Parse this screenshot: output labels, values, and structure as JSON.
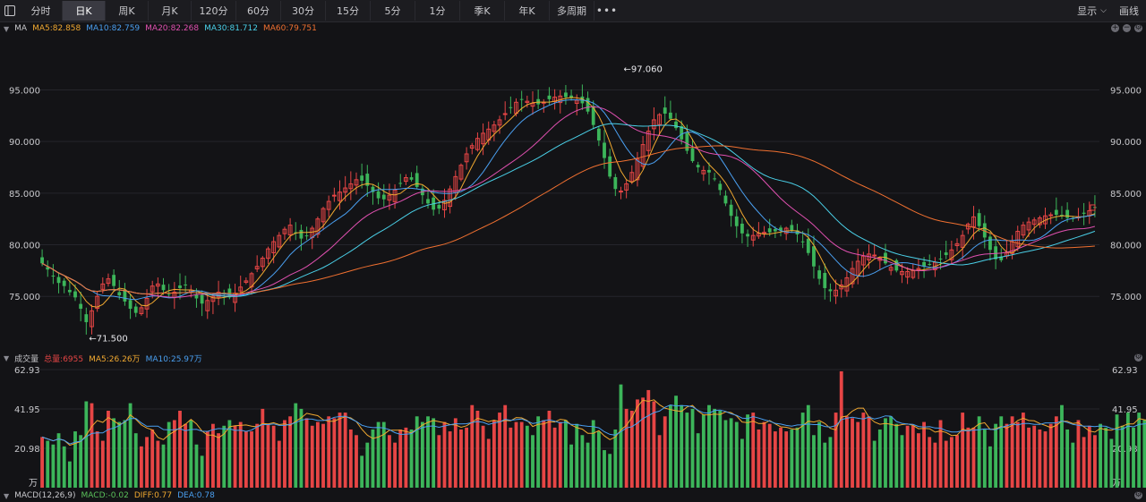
{
  "toolbar": {
    "tabs": [
      {
        "label": "分时"
      },
      {
        "label": "日K"
      },
      {
        "label": "周K"
      },
      {
        "label": "月K"
      },
      {
        "label": "120分"
      },
      {
        "label": "60分"
      },
      {
        "label": "30分"
      },
      {
        "label": "15分"
      },
      {
        "label": "5分"
      },
      {
        "label": "1分"
      },
      {
        "label": "季K"
      },
      {
        "label": "年K"
      },
      {
        "label": "多周期"
      }
    ],
    "active_index": 1,
    "more_label": "•••",
    "display_label": "显示",
    "draw_label": "画线"
  },
  "ma_legend": {
    "title": "MA",
    "items": [
      {
        "text": "MA5:82.858",
        "color": "#f0a830"
      },
      {
        "text": "MA10:82.759",
        "color": "#4a9ff0"
      },
      {
        "text": "MA20:82.268",
        "color": "#e050b0"
      },
      {
        "text": "MA30:81.712",
        "color": "#4ad0e8"
      },
      {
        "text": "MA60:79.751",
        "color": "#f07030"
      }
    ]
  },
  "volume_legend": {
    "title": "成交量",
    "items": [
      {
        "text": "总量:6955",
        "color": "#e64545"
      },
      {
        "text": "MA5:26.26万",
        "color": "#f0a830"
      },
      {
        "text": "MA10:25.97万",
        "color": "#4a9ff0"
      }
    ]
  },
  "macd_legend": {
    "title": "MACD(12,26,9)",
    "items": [
      {
        "text": "MACD:-0.02",
        "color": "#5ac05a"
      },
      {
        "text": "DIFF:0.77",
        "color": "#f0a830"
      },
      {
        "text": "DEA:0.78",
        "color": "#4a9ff0"
      }
    ]
  },
  "colors": {
    "up": "#e64545",
    "down": "#3cb55a",
    "grid": "#25252b",
    "axis_text": "#c8c8cc"
  },
  "chart_data": [
    {
      "type": "candlestick",
      "title": "",
      "y_ticks": [
        95.0,
        90.0,
        85.0,
        80.0,
        75.0
      ],
      "y_tick_labels": [
        "95.000",
        "90.000",
        "85.000",
        "80.000",
        "75.000"
      ],
      "ylim": [
        70.25,
        99.72
      ],
      "annotations": [
        {
          "label": "←97.060",
          "value": 97.06,
          "index": 105
        },
        {
          "label": "←71.500",
          "value": 71.5,
          "index": 8
        }
      ],
      "closes": [
        78.2,
        77.6,
        77.0,
        76.3,
        76.0,
        75.4,
        74.9,
        73.8,
        72.5,
        73.6,
        75.0,
        76.2,
        76.7,
        76.0,
        75.1,
        74.5,
        73.8,
        73.4,
        73.9,
        74.8,
        76.0,
        76.2,
        75.6,
        75.2,
        75.4,
        75.8,
        76.1,
        75.6,
        74.8,
        74.3,
        74.6,
        75.0,
        75.4,
        75.2,
        74.9,
        75.3,
        75.9,
        76.5,
        77.2,
        77.9,
        78.7,
        79.6,
        80.3,
        80.9,
        81.5,
        81.9,
        81.1,
        80.6,
        80.9,
        81.6,
        82.5,
        83.5,
        84.2,
        84.8,
        85.1,
        85.5,
        85.9,
        86.3,
        86.2,
        85.7,
        85.1,
        84.5,
        84.4,
        84.8,
        85.3,
        85.9,
        86.5,
        86.3,
        85.6,
        84.8,
        84.0,
        83.4,
        83.5,
        84.3,
        85.4,
        86.6,
        87.7,
        88.8,
        89.6,
        90.3,
        90.8,
        91.2,
        91.6,
        92.1,
        92.7,
        93.3,
        93.8,
        94.1,
        93.9,
        93.7,
        93.6,
        93.8,
        94.1,
        94.3,
        94.4,
        94.3,
        94.2,
        94.0,
        93.7,
        92.9,
        91.6,
        90.1,
        88.4,
        86.6,
        85.4,
        85.2,
        85.9,
        87.0,
        88.3,
        89.7,
        91.0,
        92.1,
        92.6,
        92.7,
        92.2,
        91.3,
        90.2,
        89.1,
        88.1,
        87.5,
        87.2,
        87.0,
        86.4,
        85.3,
        84.0,
        82.8,
        81.8,
        81.1,
        80.8,
        80.9,
        81.1,
        81.2,
        81.2,
        81.3,
        81.4,
        81.6,
        81.4,
        81.0,
        80.3,
        79.2,
        77.9,
        76.7,
        75.8,
        75.5,
        75.6,
        76.1,
        76.8,
        77.7,
        78.4,
        78.9,
        79.1,
        79.0,
        78.7,
        78.2,
        77.8,
        77.5,
        77.4,
        77.4,
        77.5,
        77.7,
        77.9,
        78.1,
        78.3,
        78.6,
        79.0,
        79.5,
        80.1,
        80.9,
        82.0,
        82.7,
        81.8,
        80.7,
        79.5,
        78.6,
        78.5,
        79.2,
        80.3,
        81.3,
        81.9,
        82.2,
        82.4,
        82.6,
        82.8,
        82.9,
        82.9,
        82.8,
        82.6,
        82.5,
        82.7,
        83.0,
        83.3,
        83.6
      ],
      "overlays": [
        {
          "name": "MA5",
          "color": "#f0a830",
          "window": 5
        },
        {
          "name": "MA10",
          "color": "#4a9ff0",
          "window": 10
        },
        {
          "name": "MA20",
          "color": "#e050b0",
          "window": 20
        },
        {
          "name": "MA30",
          "color": "#4ad0e8",
          "window": 30
        },
        {
          "name": "MA60",
          "color": "#f07030",
          "window": 60
        }
      ]
    },
    {
      "type": "bar",
      "title": "",
      "unit": "万",
      "y_tick_labels": [
        "62.93",
        "41.95",
        "20.98",
        "万"
      ],
      "y_ticks": [
        62.93,
        41.95,
        20.98,
        0
      ],
      "ylim": [
        0,
        62.93
      ],
      "values": [
        27,
        25,
        23,
        29,
        22,
        14,
        30,
        28,
        46,
        45,
        30,
        25,
        41,
        37,
        35,
        36,
        45,
        29,
        22,
        27,
        31,
        25,
        23,
        35,
        36,
        41,
        34,
        36,
        23,
        17,
        30,
        34,
        29,
        33,
        36,
        33,
        35,
        30,
        30,
        34,
        42,
        34,
        33,
        25,
        36,
        38,
        45,
        42,
        37,
        33,
        35,
        34,
        38,
        37,
        40,
        40,
        31,
        28,
        17,
        24,
        31,
        35,
        35,
        28,
        24,
        31,
        32,
        31,
        38,
        35,
        38,
        37,
        28,
        35,
        30,
        37,
        31,
        32,
        44,
        41,
        33,
        26,
        36,
        40,
        44,
        32,
        35,
        35,
        33,
        28,
        38,
        36,
        41,
        32,
        35,
        36,
        23,
        34,
        28,
        24,
        36,
        30,
        20,
        18,
        31,
        55,
        42,
        41,
        47,
        48,
        52,
        46,
        28,
        38,
        44,
        49,
        44,
        40,
        42,
        29,
        39,
        44,
        42,
        41,
        36,
        37,
        35,
        26,
        39,
        40,
        31,
        35,
        34,
        30,
        32,
        30,
        31,
        32,
        40,
        44,
        28,
        35,
        24,
        27,
        40,
        62,
        38,
        37,
        35,
        40,
        38,
        25,
        31,
        37,
        38,
        34,
        28,
        33,
        33,
        29,
        35,
        27,
        24,
        36,
        25,
        27,
        28,
        40,
        32,
        32,
        38,
        31,
        22,
        34,
        38,
        34,
        38,
        35,
        40,
        32,
        33,
        31,
        30,
        34,
        38,
        44,
        31,
        24,
        36,
        27,
        33,
        28,
        34,
        32,
        26,
        39,
        33,
        40,
        32,
        40,
        36,
        31,
        39,
        32,
        28,
        25,
        29,
        31,
        39,
        42,
        40
      ]
    }
  ]
}
